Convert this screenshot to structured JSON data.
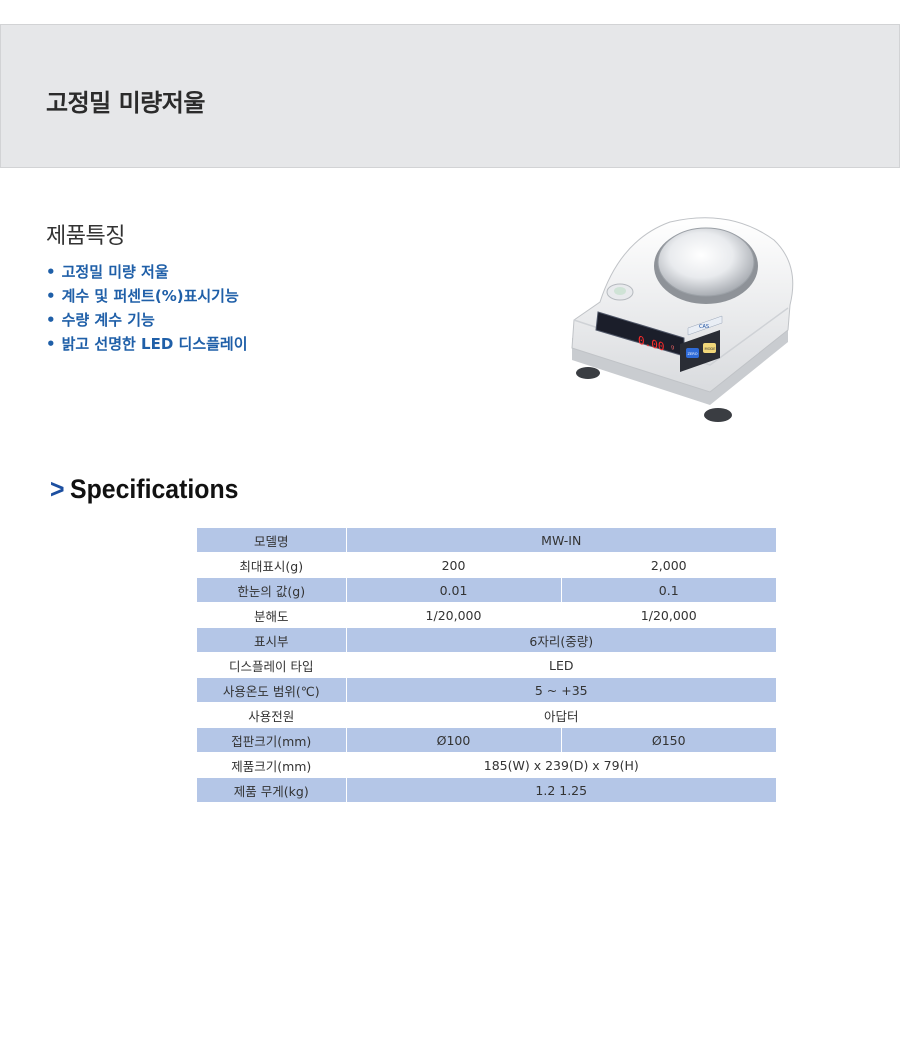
{
  "header": {
    "title": "고정밀 미량저울"
  },
  "features": {
    "heading": "제품특징",
    "items": [
      {
        "bullet": "•",
        "text": "고정밀 미량 저울"
      },
      {
        "bullet": "•",
        "text": "계수 및 퍼센트(%)표시기능"
      },
      {
        "bullet": "•",
        "text": "수량 계수 기능"
      },
      {
        "bullet": "•",
        "text": "밝고 선명한 LED 디스플레이"
      }
    ]
  },
  "product": {
    "display_reading": "0.00",
    "unit": "g",
    "brand_label": "CAS",
    "buttons": [
      "ZERO",
      "MODE"
    ]
  },
  "specs": {
    "arrow": ">",
    "heading": "Specifications",
    "rows": [
      {
        "label": "모델명",
        "value": "MW-IN"
      },
      {
        "label": "최대표시(g)",
        "values": [
          "200",
          "2,000"
        ]
      },
      {
        "label": "한눈의 값(g)",
        "values": [
          "0.01",
          "0.1"
        ]
      },
      {
        "label": "분해도",
        "values": [
          "1/20,000",
          "1/20,000"
        ]
      },
      {
        "label": "표시부",
        "value": "6자리(중량)"
      },
      {
        "label": "디스플레이 타입",
        "value": "LED"
      },
      {
        "label": "사용온도 범위(℃)",
        "value": "5 ~ +35"
      },
      {
        "label": "사용전원",
        "value": "아답터"
      },
      {
        "label": "접판크기(mm)",
        "values": [
          "Ø100",
          "Ø150"
        ]
      },
      {
        "label": "제품크기(mm)",
        "value": "185(W) x 239(D) x 79(H)"
      },
      {
        "label": "제품 무게(kg)",
        "value": "1.2 1.25"
      }
    ]
  },
  "colors": {
    "banner_bg": "#e6e7e9",
    "feature_text": "#1f5fa8",
    "table_shade": "#b4c6e7",
    "arrow": "#1c4fa0"
  }
}
